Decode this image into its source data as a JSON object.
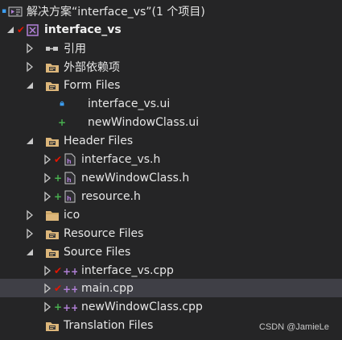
{
  "solution": {
    "label": "解决方案“interface_vs”(1 个项目)"
  },
  "project": {
    "label": "interface_vs"
  },
  "items": {
    "references": "引用",
    "external_deps": "外部依赖项",
    "form_files": "Form Files",
    "form_file_1": "interface_vs.ui",
    "form_file_2": "newWindowClass.ui",
    "header_files": "Header Files",
    "header_file_1": "interface_vs.h",
    "header_file_2": "newWindowClass.h",
    "header_file_3": "resource.h",
    "ico": "ico",
    "resource_files": "Resource Files",
    "source_files": "Source Files",
    "source_file_1": "interface_vs.cpp",
    "source_file_2": "main.cpp",
    "source_file_3": "newWindowClass.cpp",
    "translation_files": "Translation Files"
  },
  "status": {
    "modified": "✔",
    "added": "+",
    "locked": "🔒"
  },
  "colors": {
    "background": "#252526",
    "selection": "#3f3f46",
    "folder": "#dcb67a",
    "checked_out_red": "#e51400",
    "added_green": "#48b04f",
    "lock_blue": "#3c9ef2",
    "cpp_purple": "#b180d7"
  },
  "watermark": "CSDN @JamieLe"
}
